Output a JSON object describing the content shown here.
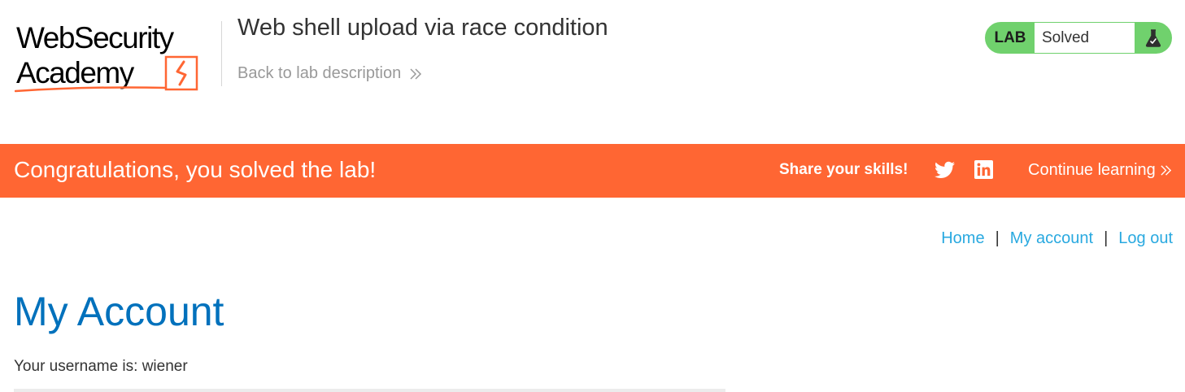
{
  "header": {
    "logo": {
      "line1": "WebSecurity",
      "line2": "Academy",
      "accent_color": "#ff6633"
    },
    "lab_title": "Web shell upload via race condition",
    "back_link_label": "Back to lab description",
    "status": {
      "lab_label": "LAB",
      "status_text": "Solved",
      "color": "#70d16d",
      "icon": "flask-icon"
    }
  },
  "banner": {
    "message": "Congratulations, you solved the lab!",
    "share_label": "Share your skills!",
    "continue_label": "Continue learning",
    "color": "#ff6633",
    "icons": [
      "twitter-icon",
      "linkedin-icon"
    ]
  },
  "nav": {
    "items": [
      {
        "label": "Home"
      },
      {
        "label": "My account"
      },
      {
        "label": "Log out"
      }
    ],
    "separator": "|",
    "link_color": "#29a9e0"
  },
  "main": {
    "title": "My Account",
    "title_color": "#0071bc",
    "username_text": "Your username is: wiener"
  }
}
